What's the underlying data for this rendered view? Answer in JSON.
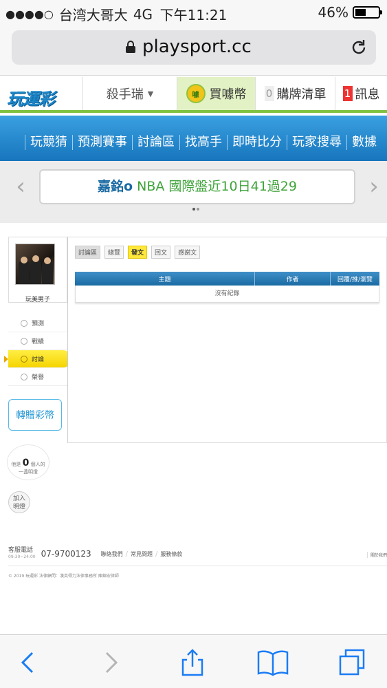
{
  "status": {
    "carrier": "台湾大哥大",
    "network": "4G",
    "time": "下午11:21",
    "battery": "46%",
    "battery_level": 0.46
  },
  "browser": {
    "url": "playsport.cc"
  },
  "header": {
    "logo": "玩運彩",
    "killer": "殺手瑞",
    "buy_coin": "買噱幣",
    "coin_badge": "噱",
    "cart_count": "0",
    "cart": "購牌清單",
    "msg_count": "1",
    "msg": "訊息"
  },
  "nav": {
    "items": [
      "玩競猜",
      "預測賽事",
      "討論區",
      "找高手",
      "即時比分",
      "玩家搜尋",
      "數據"
    ]
  },
  "ticker": {
    "user": "嘉銘o",
    "text": "NBA 國際盤近10日41過29"
  },
  "profile": {
    "name": "玩美男子",
    "menu": [
      "預測",
      "戰績",
      "討論",
      "榮譽"
    ],
    "gift_button": "轉贈彩幣",
    "fans_prefix": "他是",
    "fans_count": "0",
    "fans_suffix": "個人的",
    "fans_line2": "一盞明燈",
    "light_button_1": "加入",
    "light_button_2": "明燈"
  },
  "main": {
    "crumbs": [
      "討論區",
      "總覽",
      "發文",
      "回文",
      "感謝文"
    ],
    "columns": [
      "主題",
      "作者",
      "回覆/推/瀏覽"
    ],
    "empty": "沒有紀錄"
  },
  "footer": {
    "service_label": "客服電話",
    "service_hours": "09:30~24:00",
    "phone": "07-9700123",
    "links": [
      "聯絡我們",
      "常見問題",
      "服務條款"
    ],
    "right": "關於我們",
    "copyright": "© 2019 玩運彩 法律顧問：漢英得力法律事務所 陳錦宏律師"
  }
}
